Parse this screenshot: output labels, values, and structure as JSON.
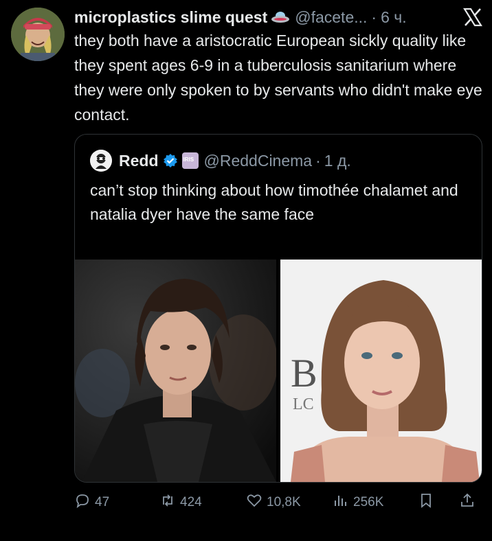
{
  "tweet": {
    "author_name": "microplastics slime quest",
    "handle": "@facete...",
    "separator": "·",
    "time": "6 ч.",
    "text": "they both have a aristocratic European sickly quality like they spent ages 6-9 in a tuberculosis sanitarium where they were only spoken to by servants who didn't make eye contact."
  },
  "quoted": {
    "author_name": "Redd",
    "handle": "@ReddCinema",
    "separator": "·",
    "time": "1 д.",
    "text": "can’t stop thinking about how timothée chalamet and natalia dyer have the same face",
    "badge_text": "IRIS",
    "photo_right_sign_letters": [
      "B",
      "LC"
    ]
  },
  "actions": {
    "replies": "47",
    "reposts": "424",
    "likes": "10,8K",
    "views": "256K"
  },
  "colors": {
    "background": "#000000",
    "text": "#e7e9ea",
    "muted": "#8b98a5",
    "border": "#2f3336",
    "verified": "#1d9bf0"
  },
  "icons": [
    "ufo-emoji-icon",
    "x-logo-icon",
    "verified-badge-icon",
    "iris-badge-icon",
    "reply-icon",
    "repost-icon",
    "like-icon",
    "views-icon",
    "bookmark-icon",
    "share-icon"
  ]
}
